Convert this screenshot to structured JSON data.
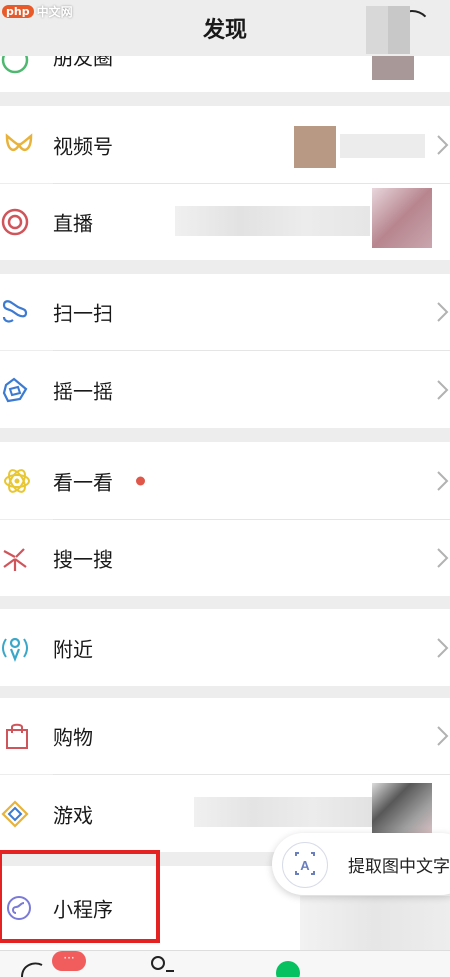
{
  "watermark": {
    "logo": "php",
    "site": "中文网"
  },
  "header": {
    "title": "发现"
  },
  "rows": [
    {
      "key": "moments",
      "label": "朋友圈"
    },
    {
      "key": "channels",
      "label": "视频号"
    },
    {
      "key": "live",
      "label": "直播"
    },
    {
      "key": "scan",
      "label": "扫一扫"
    },
    {
      "key": "shake",
      "label": "摇一摇"
    },
    {
      "key": "top-stories",
      "label": "看一看"
    },
    {
      "key": "search",
      "label": "搜一搜"
    },
    {
      "key": "nearby",
      "label": "附近"
    },
    {
      "key": "shopping",
      "label": "购物"
    },
    {
      "key": "games",
      "label": "游戏"
    },
    {
      "key": "mini-programs",
      "label": "小程序"
    }
  ],
  "popup": {
    "label": "提取图中文字"
  },
  "tabbar": {
    "badge": "···"
  },
  "colors": {
    "background": "#ededed",
    "row": "#ffffff",
    "highlight": "#e52222",
    "dot": "#e0574a",
    "channels_icon": "#e8b33c",
    "live_icon": "#d0555a",
    "scan_icon": "#3c7bd1",
    "shake_icon": "#3c7bd1",
    "top_stories_icon": "#e8c734",
    "search_icon": "#d0555a",
    "nearby_icon": "#3aa7c9",
    "shopping_icon": "#d0555a",
    "games_icon": "#3c7bd1"
  }
}
